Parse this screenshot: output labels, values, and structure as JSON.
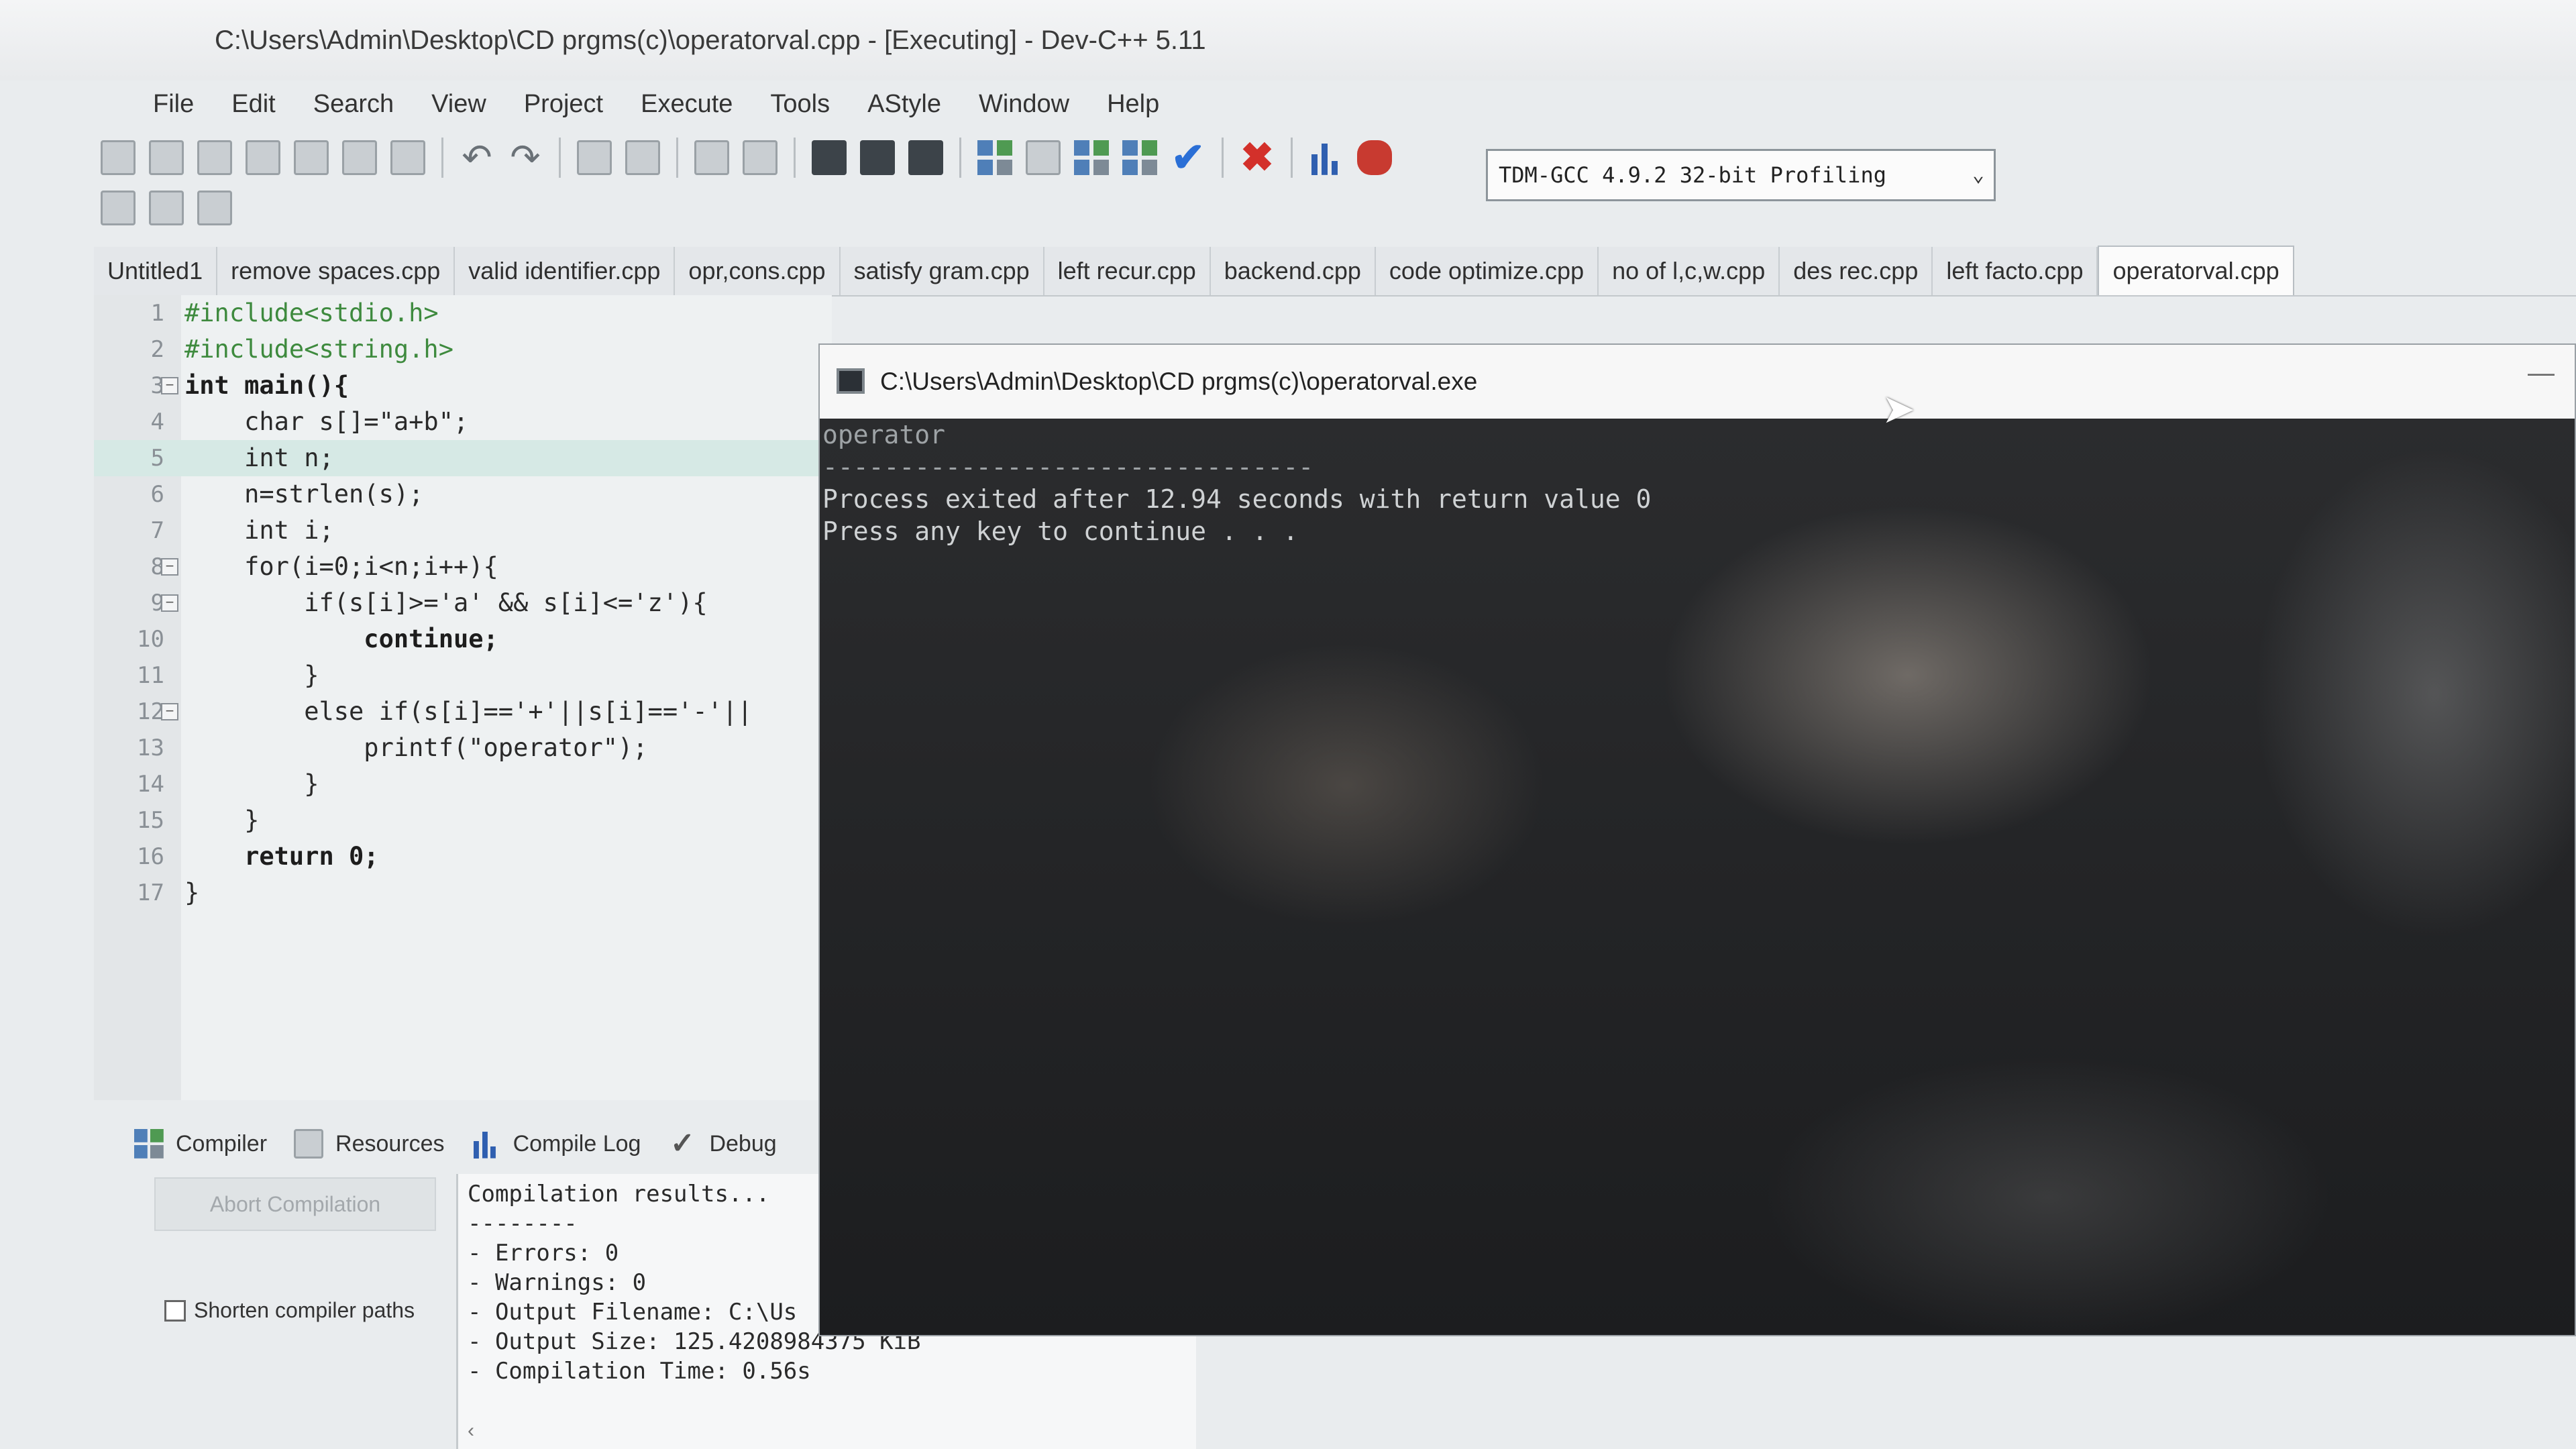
{
  "window": {
    "title": "C:\\Users\\Admin\\Desktop\\CD prgms(c)\\operatorval.cpp - [Executing] - Dev-C++ 5.11"
  },
  "menu": [
    "File",
    "Edit",
    "Search",
    "View",
    "Project",
    "Execute",
    "Tools",
    "AStyle",
    "Window",
    "Help"
  ],
  "toolbar": {
    "compiler_select": "TDM-GCC 4.9.2 32-bit Profiling"
  },
  "tabs": [
    "Untitled1",
    "remove spaces.cpp",
    "valid identifier.cpp",
    "opr,cons.cpp",
    "satisfy gram.cpp",
    "left recur.cpp",
    "backend.cpp",
    "code optimize.cpp",
    "no of l,c,w.cpp",
    "des rec.cpp",
    "left facto.cpp",
    "operatorval.cpp"
  ],
  "editor": {
    "line_numbers": [
      "1",
      "2",
      "3",
      "4",
      "5",
      "6",
      "7",
      "8",
      "9",
      "10",
      "11",
      "12",
      "13",
      "14",
      "15",
      "16",
      "17"
    ],
    "lines": [
      "#include<stdio.h>",
      "#include<string.h>",
      "int main(){",
      "    char s[]=\"a+b\";",
      "    int n;",
      "    n=strlen(s);",
      "    int i;",
      "    for(i=0;i<n;i++){",
      "        if(s[i]>='a' && s[i]<='z'){",
      "            continue;",
      "        }",
      "        else if(s[i]=='+'||s[i]=='-'||",
      "            printf(\"operator\");",
      "        }",
      "    }",
      "    return 0;",
      "}"
    ]
  },
  "bottom_panel": {
    "tabs": [
      "Compiler",
      "Resources",
      "Compile Log",
      "Debug"
    ],
    "abort_button": "Abort Compilation",
    "shorten_paths_label": "Shorten compiler paths",
    "results": [
      "Compilation results...",
      "--------",
      "- Errors: 0",
      "- Warnings: 0",
      "- Output Filename: C:\\Us",
      "- Output Size: 125.4208984375 KiB",
      "- Compilation Time: 0.56s"
    ]
  },
  "console": {
    "title": "C:\\Users\\Admin\\Desktop\\CD prgms(c)\\operatorval.exe",
    "output_line1": "operator",
    "separator": "--------------------------------",
    "output_line2": "Process exited after 12.94 seconds with return value 0",
    "output_line3": "Press any key to continue . . ."
  }
}
